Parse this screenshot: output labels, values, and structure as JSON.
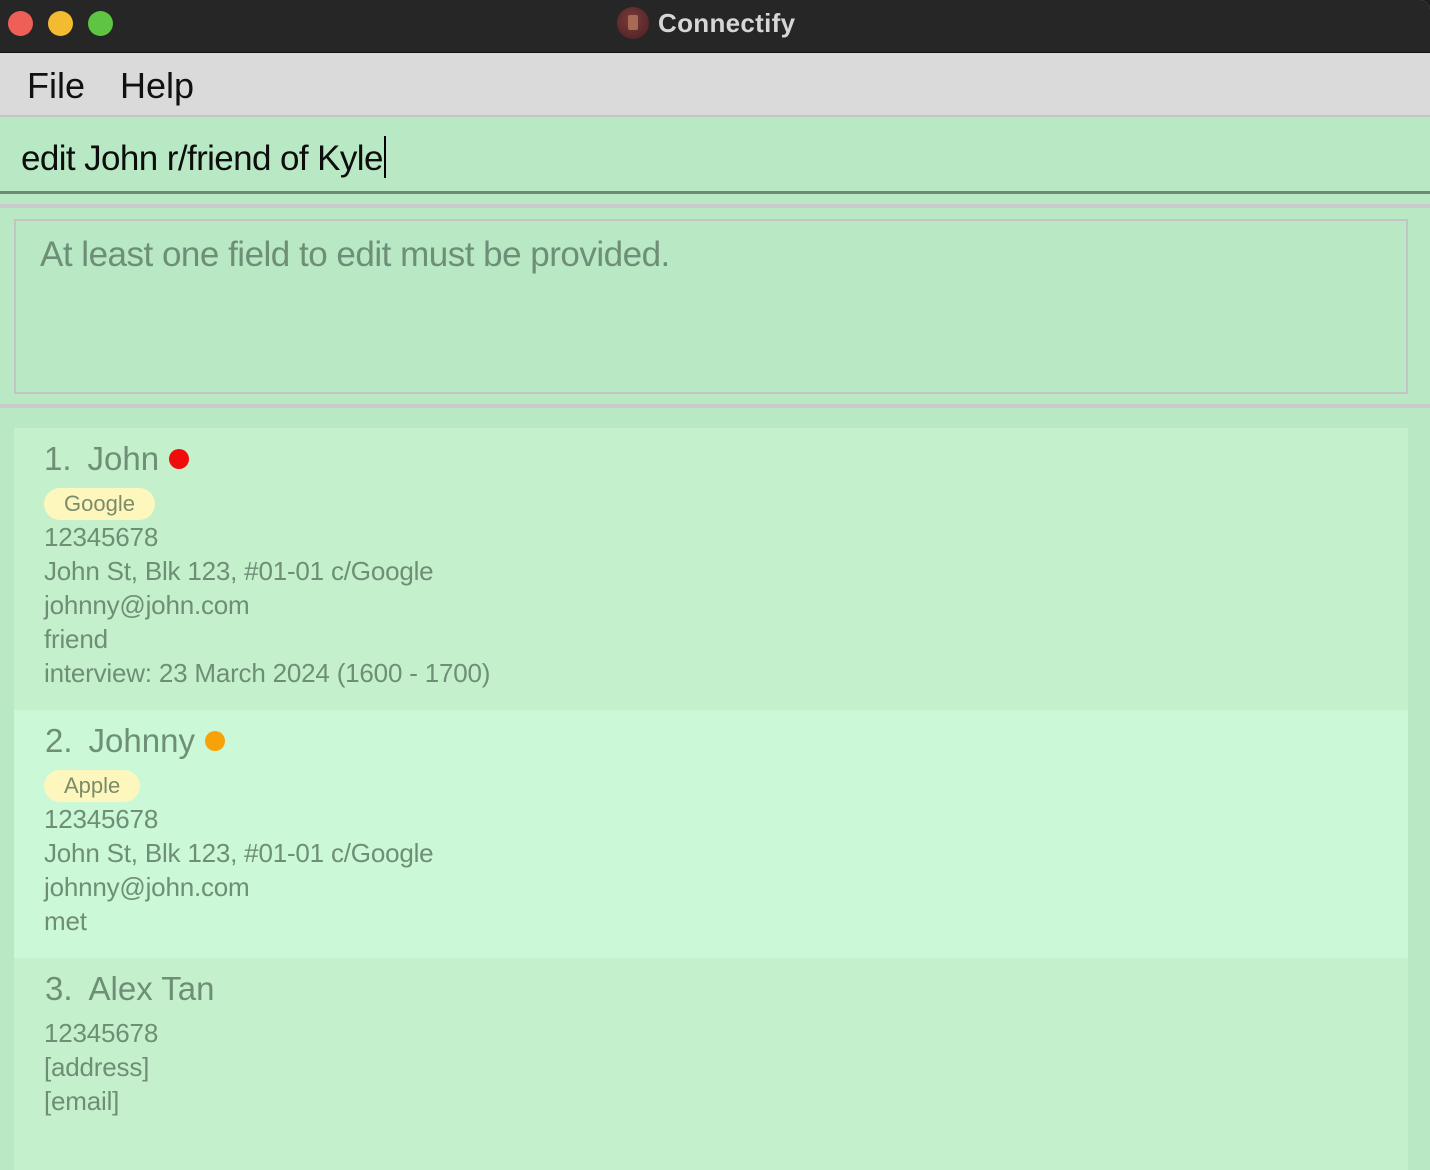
{
  "window": {
    "title": "Connectify"
  },
  "menu": {
    "file": "File",
    "help": "Help"
  },
  "command": {
    "value": "edit John r/friend of Kyle"
  },
  "result": {
    "message": "At least one field to edit must be provided."
  },
  "persons": [
    {
      "index": "1.",
      "name": "John",
      "status_color": "#f20b0b",
      "tag": "Google",
      "phone": "12345678",
      "address": "John St, Blk 123, #01-01 c/Google",
      "email": "johnny@john.com",
      "relationship": "friend",
      "interview": "interview: 23 March 2024 (1600 - 1700)"
    },
    {
      "index": "2.",
      "name": "Johnny",
      "status_color": "#f8a20a",
      "tag": "Apple",
      "phone": "12345678",
      "address": "John St, Blk 123, #01-01 c/Google",
      "email": "johnny@john.com",
      "relationship": "met"
    },
    {
      "index": "3.",
      "name": "Alex Tan",
      "phone": "12345678",
      "address": "[address]",
      "email": "[email]"
    }
  ],
  "colors": {
    "background": "#b8e9c4",
    "card_alt": "#cbf8d6",
    "tag_bg": "#fdf6bd"
  }
}
